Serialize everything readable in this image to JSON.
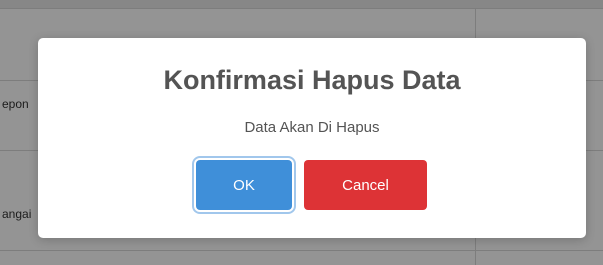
{
  "background": {
    "row1_text": "epon",
    "row2_text": "angai"
  },
  "dialog": {
    "title": "Konfirmasi Hapus Data",
    "message": "Data Akan Di Hapus",
    "ok_label": "OK",
    "cancel_label": "Cancel"
  },
  "colors": {
    "ok_button": "#3f8fd9",
    "cancel_button": "#dd3336",
    "overlay": "rgba(0,0,0,0.42)"
  }
}
